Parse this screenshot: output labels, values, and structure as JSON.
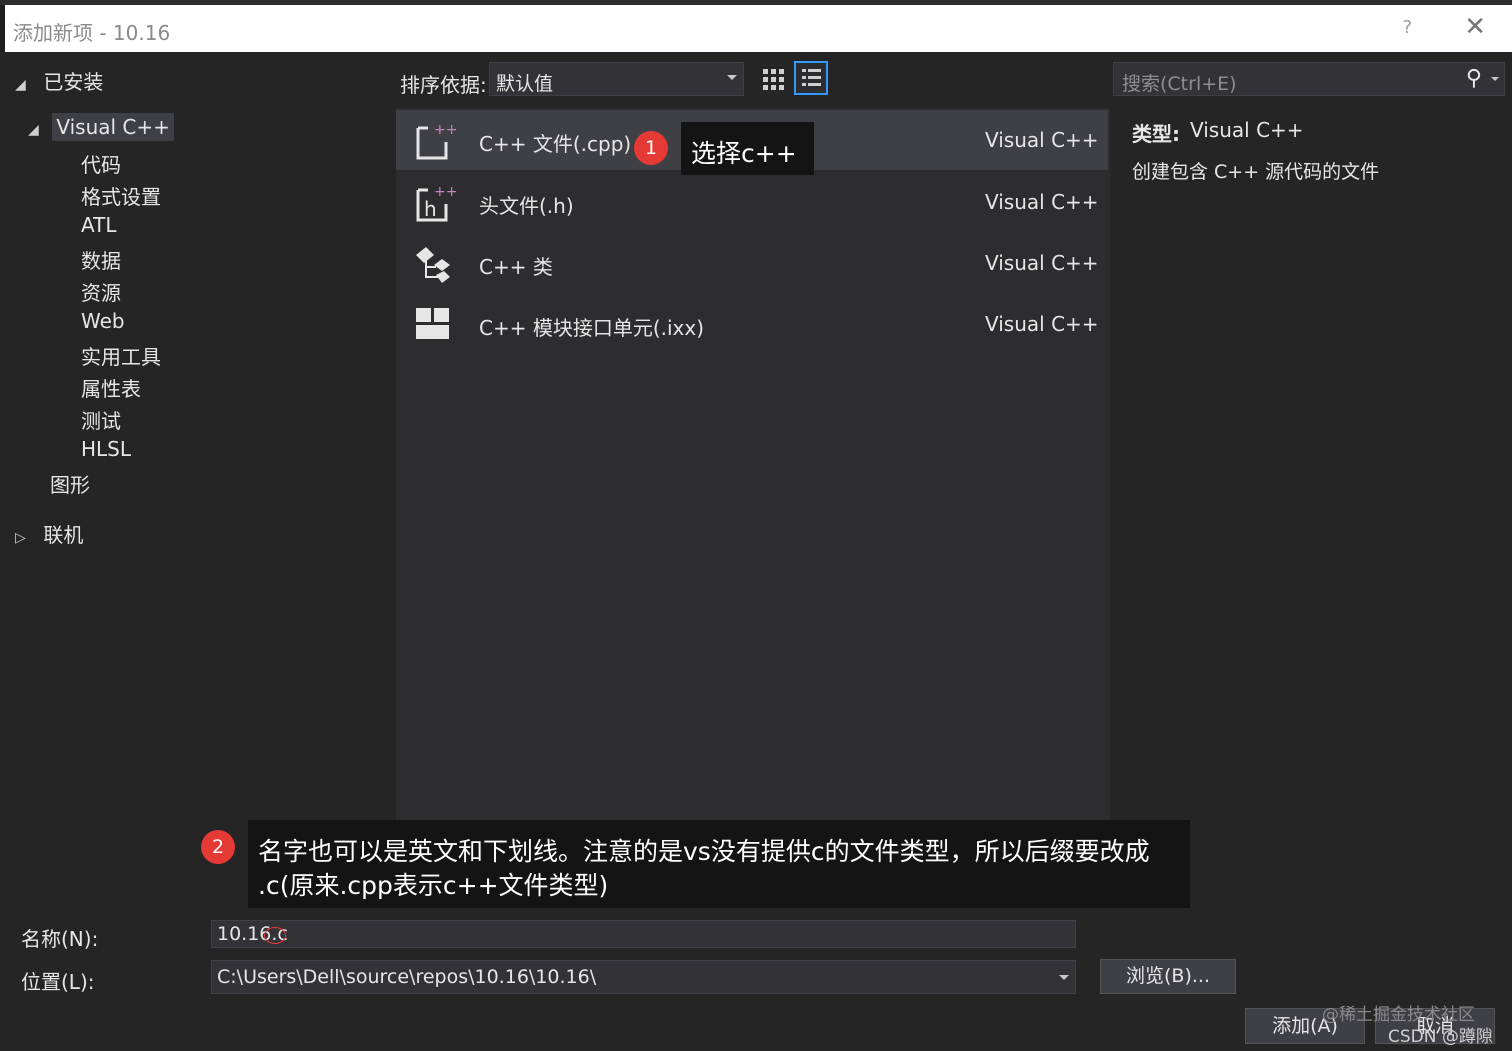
{
  "window": {
    "title": "添加新项 - 10.16",
    "help": "?",
    "close": "✕"
  },
  "tree": {
    "installed": "已安装",
    "visual_cpp": "Visual C++",
    "children": [
      "代码",
      "格式设置",
      "ATL",
      "数据",
      "资源",
      "Web",
      "实用工具",
      "属性表",
      "测试",
      "HLSL"
    ],
    "graphics": "图形",
    "online": "联机"
  },
  "sort": {
    "label": "排序依据:",
    "value": "默认值"
  },
  "search": {
    "placeholder": "搜索(Ctrl+E)"
  },
  "templates": [
    {
      "name": "C++ 文件(.cpp)",
      "lang": "Visual C++",
      "icon": "cpp-file-icon",
      "selected": true
    },
    {
      "name": "头文件(.h)",
      "lang": "Visual C++",
      "icon": "header-file-icon"
    },
    {
      "name": "C++ 类",
      "lang": "Visual C++",
      "icon": "cpp-class-icon"
    },
    {
      "name": "C++ 模块接口单元(.ixx)",
      "lang": "Visual C++",
      "icon": "module-icon"
    }
  ],
  "details": {
    "type_label": "类型:",
    "type_value": "Visual C++",
    "description": "创建包含 C++ 源代码的文件"
  },
  "annotations": {
    "badge1": "1",
    "note1": "选择c++",
    "badge2": "2",
    "note2_line1": "名字也可以是英文和下划线。注意的是vs没有提供c的文件类型，所以后缀要改成",
    "note2_line2": ".c(原来.cpp表示c++文件类型)"
  },
  "form": {
    "name_label": "名称(N):",
    "name_value": "10.16.c",
    "location_label": "位置(L):",
    "location_value": "C:\\Users\\Dell\\source\\repos\\10.16\\10.16\\",
    "browse_button": "浏览(B)...",
    "add_button": "添加(A)",
    "cancel_button": "取消"
  },
  "watermark": {
    "line1": "@稀土掘金技术社区",
    "line2": "CSDN @蹲隙"
  },
  "colors": {
    "accent": "#3399ff",
    "badge": "#e53935",
    "background": "#252526",
    "selected": "#3f3f46"
  }
}
